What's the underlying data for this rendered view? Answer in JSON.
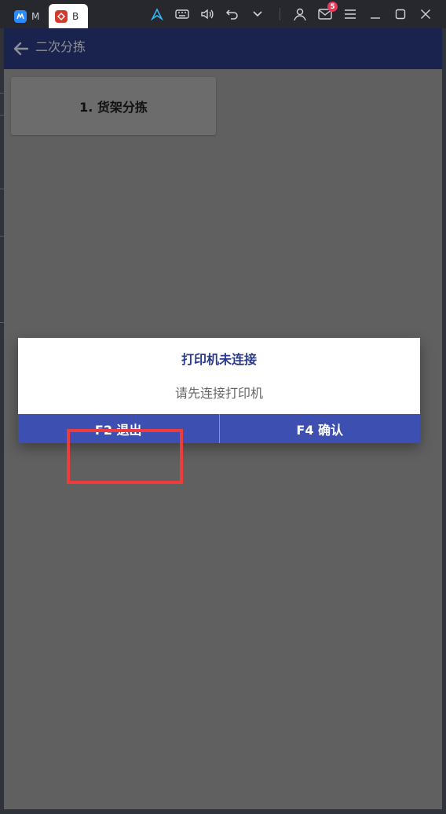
{
  "titlebar": {
    "tabs": [
      {
        "label": "M",
        "icon": "app-blue-icon"
      },
      {
        "label": "B",
        "icon": "app-red-icon"
      }
    ],
    "mail_badge": "5",
    "tools": [
      "pointer-icon",
      "keyboard-icon",
      "volume-icon",
      "undo-icon",
      "chevron-down-icon",
      "account-icon",
      "mail-icon",
      "menu-icon",
      "minimize-icon",
      "maximize-icon",
      "close-icon"
    ]
  },
  "appbar": {
    "title": "二次分拣"
  },
  "menu": {
    "items": [
      {
        "label": "1. 货架分拣"
      }
    ]
  },
  "dialog": {
    "title": "打印机未连接",
    "message": "请先连接打印机",
    "buttons": {
      "exit": "F2 退出",
      "confirm": "F4 确认"
    }
  },
  "colors": {
    "appbar_bg": "#1a224e",
    "dialog_title": "#2a3a8c",
    "button_bar": "#3e4fb2",
    "highlight": "#ef3b3b",
    "overlay": "#606060"
  }
}
